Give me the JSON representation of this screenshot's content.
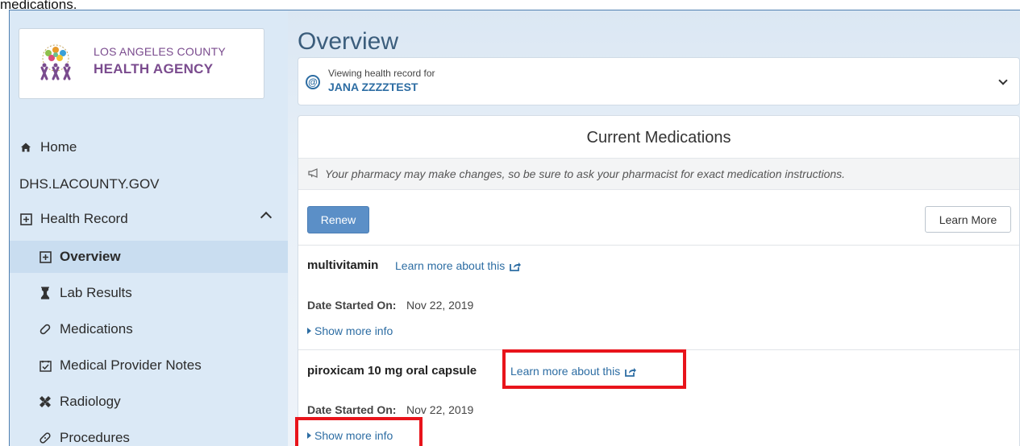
{
  "caption": "medications.",
  "logo": {
    "line1": "LOS ANGELES COUNTY",
    "line2": "HEALTH AGENCY"
  },
  "sidebar": {
    "items": [
      {
        "label": "Home",
        "icon": "home-icon"
      },
      {
        "label": "DHS.LACOUNTY.GOV"
      },
      {
        "label": "Health Record",
        "icon": "health-record-icon",
        "expanded": true
      },
      {
        "label": "Overview",
        "icon": "health-record-icon",
        "active": true
      },
      {
        "label": "Lab Results",
        "icon": "flask-icon"
      },
      {
        "label": "Medications",
        "icon": "pill-icon"
      },
      {
        "label": "Medical Provider Notes",
        "icon": "notes-icon"
      },
      {
        "label": "Radiology",
        "icon": "radiology-icon"
      },
      {
        "label": "Procedures",
        "icon": "bandage-icon"
      }
    ]
  },
  "main": {
    "title": "Overview",
    "patient": {
      "viewing_text": "Viewing health record for",
      "name": "JANA ZZZZTEST"
    },
    "card": {
      "title": "Current Medications",
      "notice": "Your pharmacy may make changes, so be sure to ask your pharmacist for exact medication instructions.",
      "renew_label": "Renew",
      "learn_more_label": "Learn More",
      "medications": [
        {
          "name": "multivitamin",
          "link": "Learn more about this",
          "date_label": "Date Started On:",
          "date": "Nov 22, 2019",
          "show_more": "Show more info"
        },
        {
          "name": "piroxicam 10 mg oral capsule",
          "link": "Learn more about this",
          "date_label": "Date Started On:",
          "date": "Nov 22, 2019",
          "show_more": "Show more info"
        }
      ]
    }
  },
  "colors": {
    "accent": "#2d6da3",
    "sidebar_bg": "#dbe9f6",
    "highlight": "#e8141b",
    "logo_purple": "#7a4b8e"
  }
}
